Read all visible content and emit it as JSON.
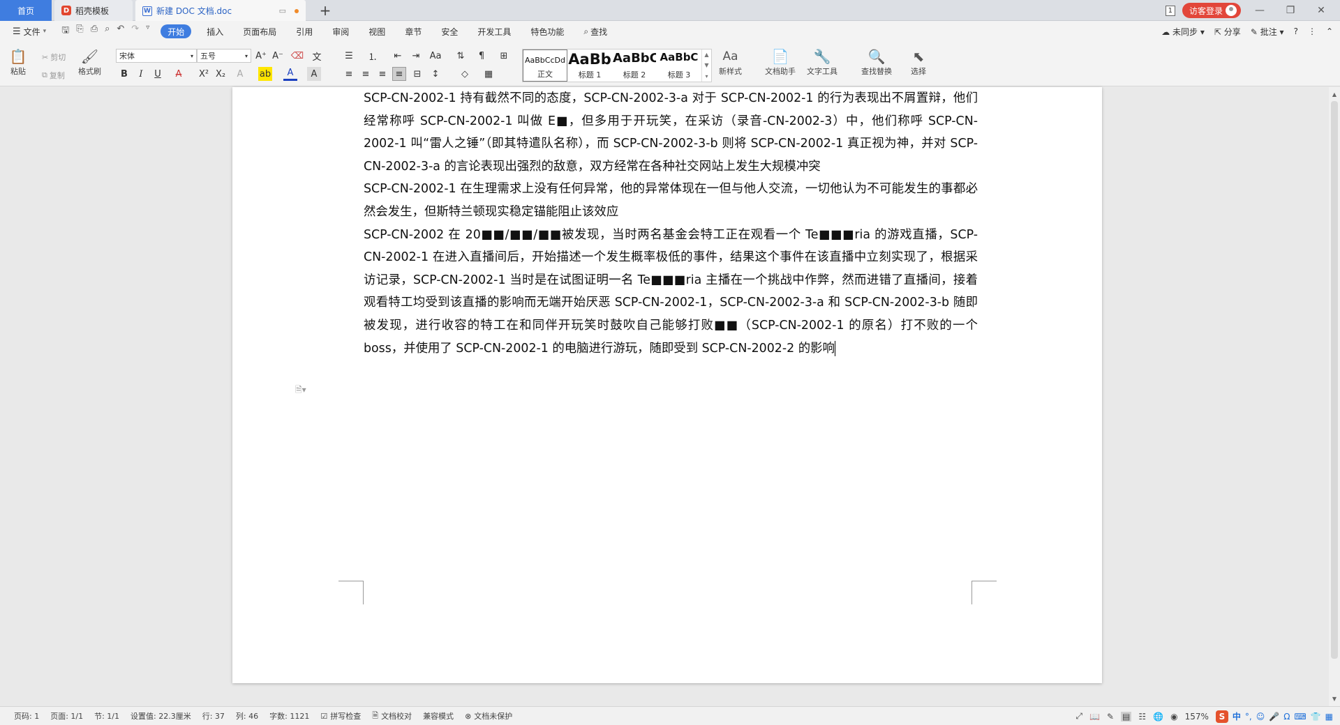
{
  "tabs": {
    "home": "首页",
    "template": "稻壳模板",
    "document": "新建 DOC 文档.doc",
    "new_tab": "+"
  },
  "titlebar": {
    "window_count": "1",
    "login": "访客登录"
  },
  "menu": {
    "file": "文件",
    "items": [
      "开始",
      "插入",
      "页面布局",
      "引用",
      "审阅",
      "视图",
      "章节",
      "安全",
      "开发工具",
      "特色功能"
    ],
    "search": "查找",
    "sync": "未同步",
    "share": "分享",
    "comment": "批注",
    "help": "?"
  },
  "ribbon": {
    "paste": "粘贴",
    "cut": "剪切",
    "copy": "复制",
    "format_painter": "格式刷",
    "font_name": "宋体",
    "font_size": "五号",
    "styles": [
      {
        "preview": "AaBbCcDd",
        "name": "正文"
      },
      {
        "preview": "AaBb",
        "name": "标题 1"
      },
      {
        "preview": "AaBbC",
        "name": "标题 2"
      },
      {
        "preview": "AaBbC",
        "name": "标题 3"
      }
    ],
    "new_style": "新样式",
    "doc_assistant": "文档助手",
    "text_tools": "文字工具",
    "find_replace": "查找替换",
    "select": "选择"
  },
  "document": {
    "paragraphs": [
      "SCP-CN-2002-1 持有截然不同的态度，SCP-CN-2002-3-a 对于 SCP-CN-2002-1 的行为表现出不屑置辩，他们经常称呼 SCP-CN-2002-1 叫做 E■，但多用于开玩笑，在采访（录音-CN-2002-3）中，他们称呼 SCP-CN-2002-1 叫“雷人之锤”（即其特遣队名称），而 SCP-CN-2002-3-b 则将 SCP-CN-2002-1 真正视为神，并对 SCP-CN-2002-3-a 的言论表现出强烈的敌意，双方经常在各种社交网站上发生大规模冲突",
      "SCP-CN-2002-1 在生理需求上没有任何异常，他的异常体现在一但与他人交流，一切他认为不可能发生的事都必然会发生，但斯特兰顿现实稳定锚能阻止该效应",
      "SCP-CN-2002 在 20■■/■■/■■被发现，当时两名基金会特工正在观看一个 Te■■■ria 的游戏直播，SCP-CN-2002-1 在进入直播间后，开始描述一个发生概率极低的事件，结果这个事件在该直播中立刻实现了，根据采访记录，SCP-CN-2002-1 当时是在试图证明一名 Te■■■ria 主播在一个挑战中作弊，然而进错了直播间，接着观看特工均受到该直播的影响而无端开始厌恶 SCP-CN-2002-1，SCP-CN-2002-3-a 和 SCP-CN-2002-3-b 随即被发现，进行收容的特工在和同伴开玩笑时鼓吹自己能够打败■■（SCP-CN-2002-1 的原名）打不败的一个 boss，并使用了 SCP-CN-2002-1 的电脑进行游玩，随即受到 SCP-CN-2002-2 的影响"
    ]
  },
  "status": {
    "page_num": "页码: 1",
    "pages": "页面: 1/1",
    "section": "节: 1/1",
    "setting": "设置值: 22.3厘米",
    "row": "行: 37",
    "col": "列: 46",
    "word_count": "字数: 1121",
    "spell_check": "拼写检查",
    "proofread": "文档校对",
    "compat": "兼容模式",
    "protect": "文档未保护",
    "zoom": "157%"
  },
  "ime": {
    "lang": "中"
  },
  "colors": {
    "accent": "#3f7de0",
    "login": "#e2463a",
    "ime": "#e4522d"
  }
}
